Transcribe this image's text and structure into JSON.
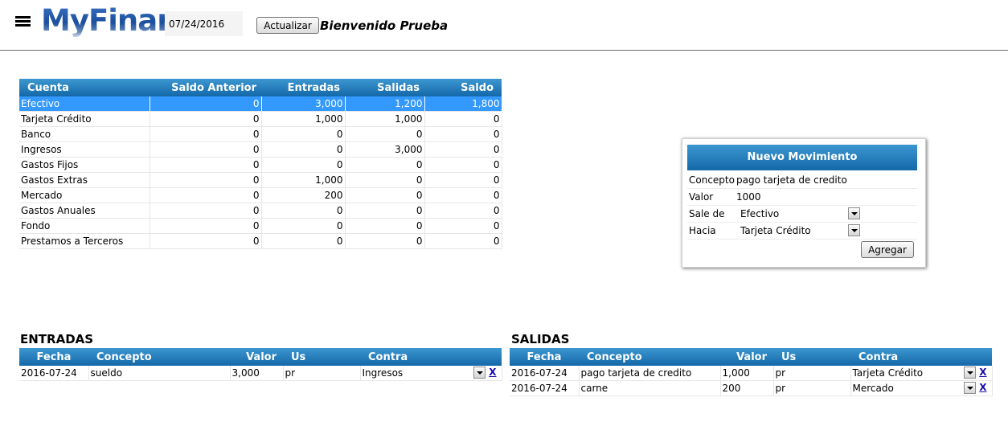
{
  "header": {
    "logo": "MyFinan",
    "date": "07/24/2016",
    "update_label": "Actualizar",
    "welcome": "Bienvenido Prueba"
  },
  "cuentas": {
    "columns": [
      "Cuenta",
      "Saldo Anterior",
      "Entradas",
      "Salidas",
      "Saldo"
    ],
    "rows": [
      [
        "Efectivo",
        "0",
        "3,000",
        "1,200",
        "1,800"
      ],
      [
        "Tarjeta Crédito",
        "0",
        "1,000",
        "1,000",
        "0"
      ],
      [
        "Banco",
        "0",
        "0",
        "0",
        "0"
      ],
      [
        "Ingresos",
        "0",
        "0",
        "3,000",
        "0"
      ],
      [
        "Gastos Fijos",
        "0",
        "0",
        "0",
        "0"
      ],
      [
        "Gastos Extras",
        "0",
        "1,000",
        "0",
        "0"
      ],
      [
        "Mercado",
        "0",
        "200",
        "0",
        "0"
      ],
      [
        "Gastos Anuales",
        "0",
        "0",
        "0",
        "0"
      ],
      [
        "Fondo",
        "0",
        "0",
        "0",
        "0"
      ],
      [
        "Prestamos a Terceros",
        "0",
        "0",
        "0",
        "0"
      ]
    ]
  },
  "nuevo_movimiento": {
    "title": "Nuevo Movimiento",
    "concepto_label": "Concepto",
    "concepto_value": "pago tarjeta de credito",
    "valor_label": "Valor",
    "valor_value": "1000",
    "sale_de_label": "Sale de",
    "sale_de_value": "Efectivo",
    "hacia_label": "Hacia",
    "hacia_value": "Tarjeta Crédito",
    "add_label": "Agregar"
  },
  "entradas": {
    "title": "ENTRADAS",
    "columns": [
      "Fecha",
      "Concepto",
      "Valor",
      "Us",
      "Contra"
    ],
    "rows": [
      {
        "fecha": "2016-07-24",
        "concepto": "sueldo",
        "valor": "3,000",
        "us": "pr",
        "contra": "Ingresos",
        "delete": "X"
      }
    ]
  },
  "salidas": {
    "title": "SALIDAS",
    "columns": [
      "Fecha",
      "Concepto",
      "Valor",
      "Us",
      "Contra"
    ],
    "rows": [
      {
        "fecha": "2016-07-24",
        "concepto": "pago tarjeta de credito",
        "valor": "1,000",
        "us": "pr",
        "contra": "Tarjeta Crédito",
        "delete": "X"
      },
      {
        "fecha": "2016-07-24",
        "concepto": "carne",
        "valor": "200",
        "us": "pr",
        "contra": "Mercado",
        "delete": "X"
      }
    ]
  }
}
